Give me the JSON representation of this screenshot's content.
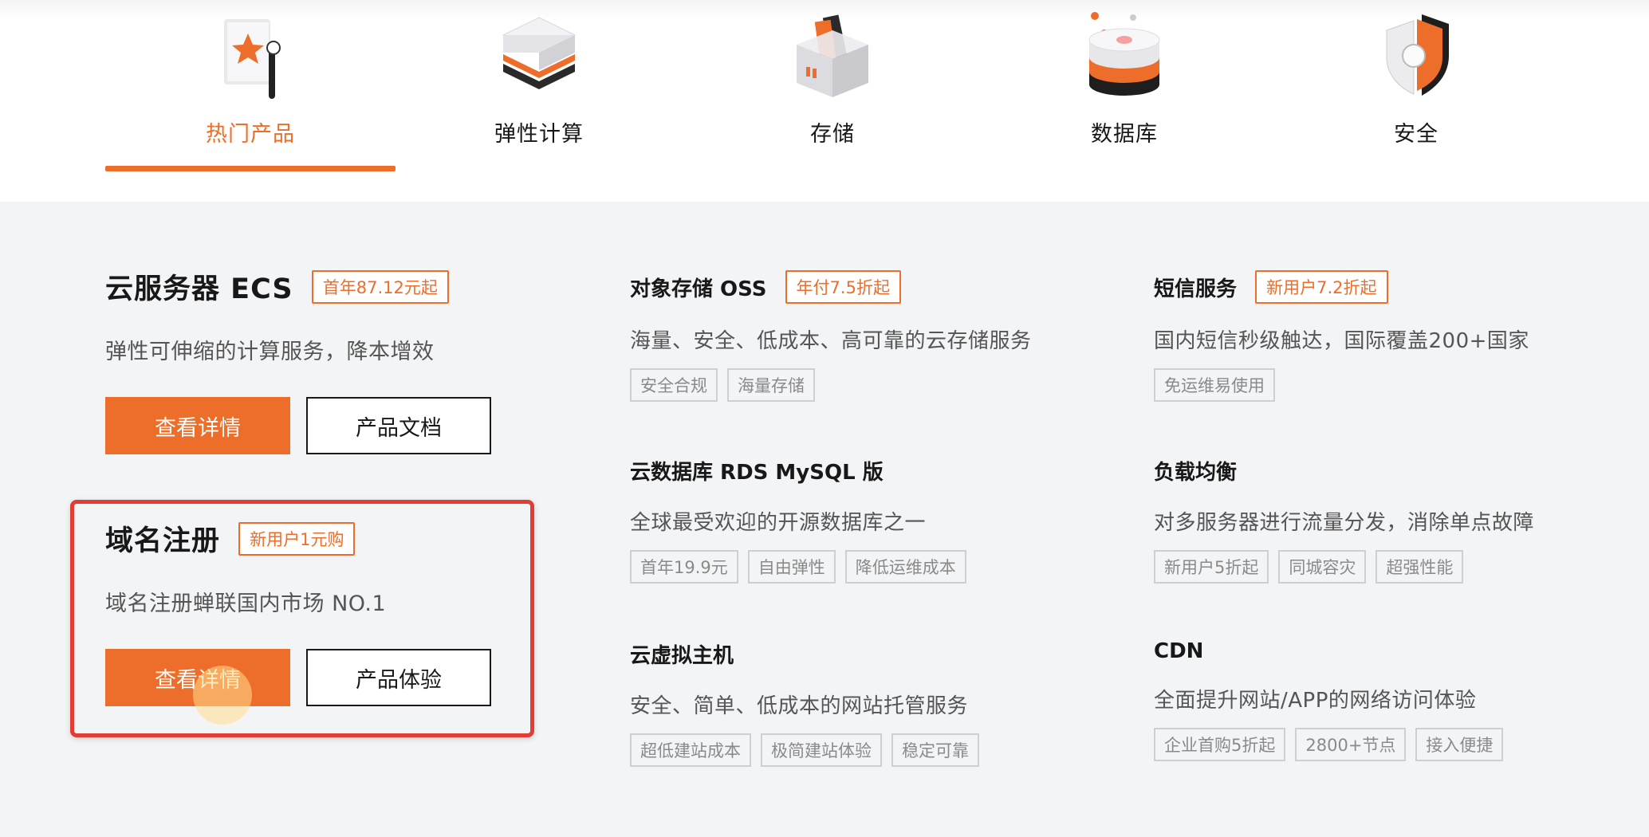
{
  "tabs": [
    {
      "label": "热门产品",
      "icon": "hot-products-flag-icon",
      "active": true
    },
    {
      "label": "弹性计算",
      "icon": "elastic-compute-server-icon",
      "active": false
    },
    {
      "label": "存储",
      "icon": "storage-box-icon",
      "active": false
    },
    {
      "label": "数据库",
      "icon": "database-cylinder-icon",
      "active": false
    },
    {
      "label": "安全",
      "icon": "security-shield-icon",
      "active": false
    }
  ],
  "products": {
    "ecs": {
      "title": "云服务器 ECS",
      "promo": "首年87.12元起",
      "desc": "弹性可伸缩的计算服务，降本增效",
      "primary_btn": "查看详情",
      "secondary_btn": "产品文档"
    },
    "domain": {
      "title": "域名注册",
      "promo": "新用户1元购",
      "desc": "域名注册蝉联国内市场 NO.1",
      "primary_btn": "查看详情",
      "secondary_btn": "产品体验"
    },
    "oss": {
      "title": "对象存储 OSS",
      "promo": "年付7.5折起",
      "desc": "海量、安全、低成本、高可靠的云存储服务",
      "tags": [
        "安全合规",
        "海量存储"
      ]
    },
    "sms": {
      "title": "短信服务",
      "promo": "新用户7.2折起",
      "desc": "国内短信秒级触达，国际覆盖200+国家",
      "tags": [
        "免运维易使用"
      ]
    },
    "rds": {
      "title": "云数据库 RDS MySQL 版",
      "desc": "全球最受欢迎的开源数据库之一",
      "tags": [
        "首年19.9元",
        "自由弹性",
        "降低运维成本"
      ]
    },
    "slb": {
      "title": "负载均衡",
      "desc": "对多服务器进行流量分发，消除单点故障",
      "tags": [
        "新用户5折起",
        "同城容灾",
        "超强性能"
      ]
    },
    "vhost": {
      "title": "云虚拟主机",
      "desc": "安全、简单、低成本的网站托管服务",
      "tags": [
        "超低建站成本",
        "极简建站体验",
        "稳定可靠"
      ]
    },
    "cdn": {
      "title": "CDN",
      "desc": "全面提升网站/APP的网络访问体验",
      "tags": [
        "企业首购5折起",
        "2800+节点",
        "接入便捷"
      ]
    }
  },
  "colors": {
    "accent": "#ed6d2a",
    "highlight": "#e13c35",
    "bg": "#f3f4f6"
  }
}
